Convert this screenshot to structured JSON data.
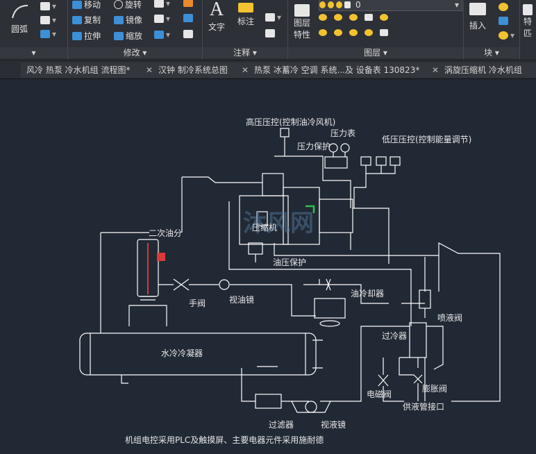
{
  "ribbon": {
    "draw": {
      "arc_label": "圆弧"
    },
    "modify": {
      "title": "修改",
      "move": "移动",
      "rotate": "旋转",
      "copy": "复制",
      "mirror": "镜像",
      "stretch": "拉伸",
      "scale": "缩放"
    },
    "annotation": {
      "title": "注释",
      "text": "文字",
      "dimension": "标注"
    },
    "layers": {
      "title": "图层",
      "props_line1": "图层",
      "props_line2": "特性",
      "layer_value": "0"
    },
    "block": {
      "title": "块",
      "insert": "插入"
    },
    "props": {
      "line1": "特",
      "line2": "匹"
    }
  },
  "tabs": [
    {
      "label": "风冷 热泵 冷水机组 流程图*"
    },
    {
      "label": "汉钟 制冷系统总图"
    },
    {
      "label": "热泵 冰蓄冷 空调 系统...及 设备表 130823*"
    },
    {
      "label": "涡旋压缩机 冷水机组"
    }
  ],
  "drawing": {
    "labels": {
      "hp_switch": "高压压控(控制油冷风机)",
      "gauge": "压力表",
      "pressure_protect": "压力保护",
      "lp_switch": "低压压控(控制能量调节)",
      "secondary_separator": "二次油分",
      "compressor": "压缩机",
      "oil_pressure": "油压保护",
      "oil_cooler": "油冷却器",
      "hand_valve": "手阀",
      "sight_glass_oil": "视油镜",
      "spray_valve": "喷液阀",
      "condenser": "水冷冷凝器",
      "subcooler": "过冷器",
      "solenoid": "电磁阀",
      "expansion": "膨胀阀",
      "supply_port": "供液管接口",
      "filter": "过滤器",
      "sight_glass_liquid": "视液镜",
      "note": "机组电控采用PLC及触摸屏、主要电器元件采用施耐德"
    },
    "watermark": "沐风网"
  },
  "colors": {
    "canvas_bg": "#212934",
    "line": "#ffffff",
    "accent_red": "#d83a3a",
    "accent_green": "#2fc04a"
  }
}
